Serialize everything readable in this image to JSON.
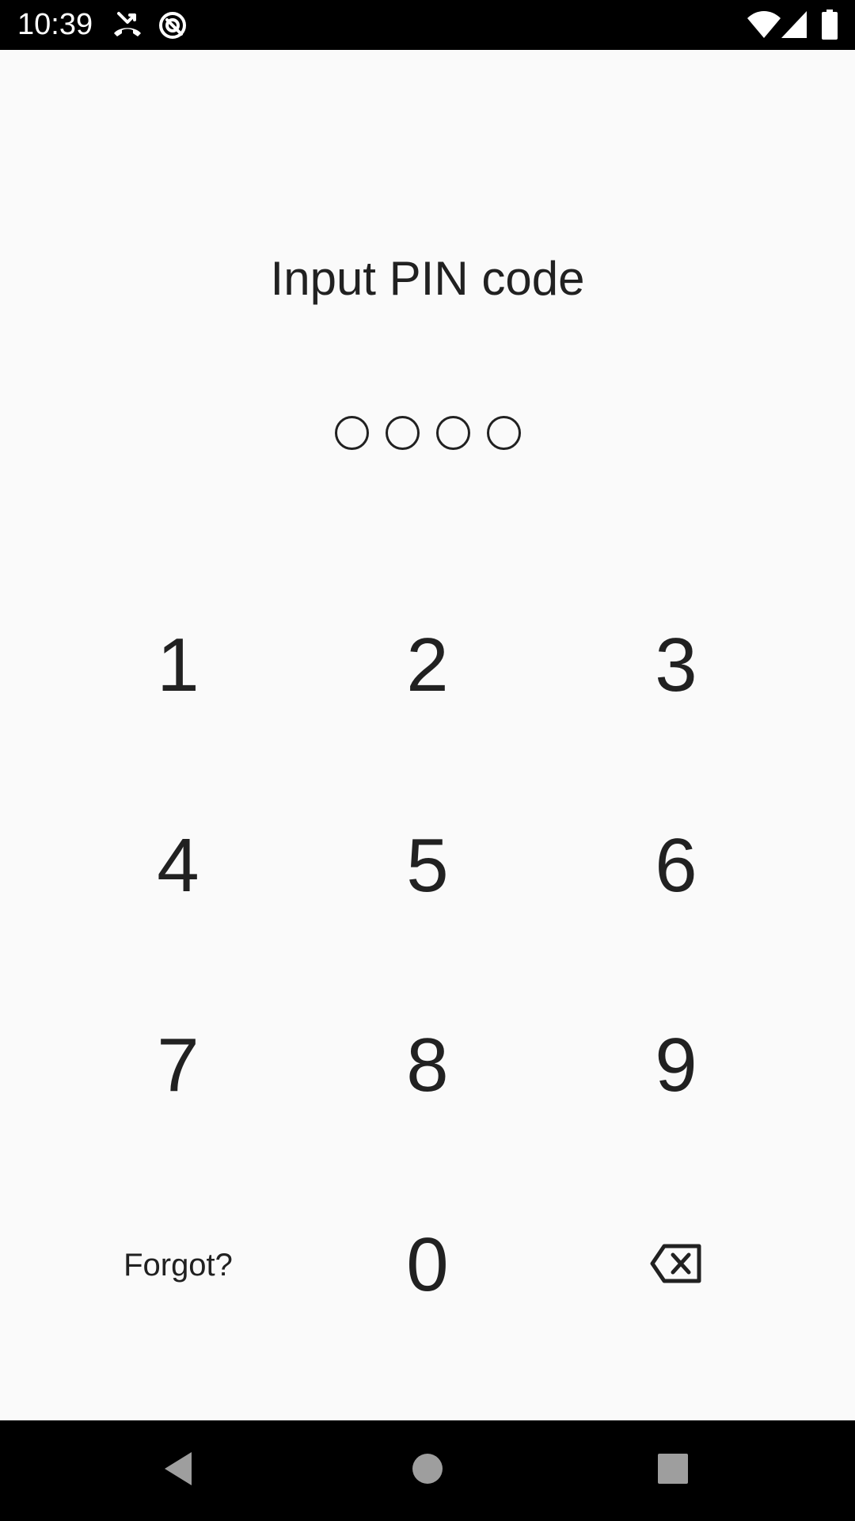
{
  "status_bar": {
    "time": "10:39",
    "icons_left": [
      "missed-call-icon",
      "data-saver-icon"
    ],
    "icons_right": [
      "wifi-icon",
      "cell-signal-icon",
      "battery-icon"
    ]
  },
  "title": "Input PIN code",
  "pin": {
    "length": 4,
    "entered": 0
  },
  "keypad": {
    "keys": [
      "1",
      "2",
      "3",
      "4",
      "5",
      "6",
      "7",
      "8",
      "9"
    ],
    "forgot_label": "Forgot?",
    "zero": "0",
    "backspace_icon": "backspace-icon"
  },
  "nav_bar": {
    "icons": [
      "back-icon",
      "home-icon",
      "recents-icon"
    ]
  },
  "colors": {
    "background": "#fafafa",
    "text": "#212121",
    "bars": "#000000",
    "nav_icon": "#9e9e9e"
  }
}
